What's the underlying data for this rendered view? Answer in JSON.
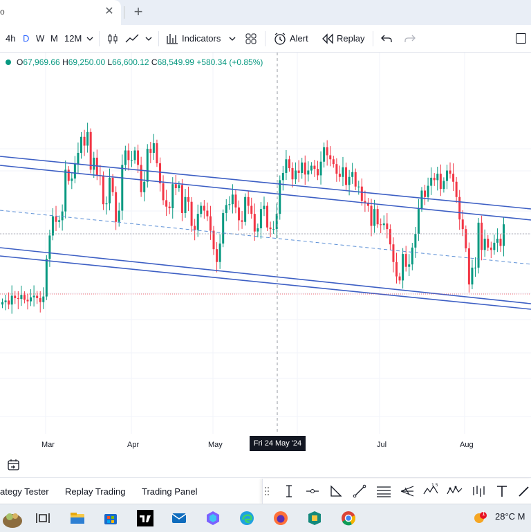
{
  "browser": {
    "tab_glyph": "o",
    "close_glyph": "✕",
    "newtab_glyph": "+"
  },
  "toolbar": {
    "intervals": [
      "4h",
      "D",
      "W",
      "M",
      "12M"
    ],
    "active_interval": "D",
    "indicators_label": "Indicators",
    "alert_label": "Alert",
    "replay_label": "Replay"
  },
  "legend": {
    "open_label": "O",
    "open": "67,969.66",
    "high_label": "H",
    "high": "69,250.00",
    "low_label": "L",
    "low": "66,600.12",
    "close_label": "C",
    "close": "68,549.99",
    "change": "+580.34 (+0.85%)"
  },
  "date_axis": {
    "ticks": [
      "Mar",
      "Apr",
      "May",
      "Jul",
      "Aug"
    ],
    "crosshair_label": "Fri 24 May '24"
  },
  "bottom_tabs": [
    "ategy Tester",
    "Replay Trading",
    "Trading Panel"
  ],
  "taskbar": {
    "temperature": "28°C",
    "weather_suffix": "M",
    "badge": "1"
  },
  "colors": {
    "up": "#089981",
    "down": "#f23645",
    "channel": "#3d5fc4",
    "midline": "#5b8fd6",
    "accent": "#2962ff"
  },
  "chart_data": {
    "type": "candlestick",
    "symbol_interval": "D",
    "period": "Feb–Aug 2024",
    "x_ticks": [
      "Mar",
      "Apr",
      "May",
      "Jul",
      "Aug"
    ],
    "crosshair_date": "Fri 24 May '24",
    "last_bar": {
      "open": 67969.66,
      "high": 69250.0,
      "low": 66600.12,
      "close": 68549.99,
      "change": 580.34,
      "change_pct": 0.85
    },
    "closes": [
      51800,
      52000,
      51500,
      52600,
      52300,
      52200,
      52700,
      52100,
      51900,
      52400,
      52600,
      52300,
      51800,
      52500,
      57200,
      60100,
      62500,
      61800,
      62000,
      63100,
      68300,
      66900,
      67200,
      69000,
      70400,
      72400,
      71300,
      73000,
      68300,
      69800,
      67600,
      67500,
      64000,
      64100,
      67300,
      65500,
      61800,
      63200,
      68900,
      70700,
      69500,
      69500,
      70700,
      68900,
      65500,
      66800,
      70900,
      70400,
      71600,
      69100,
      66600,
      64500,
      63700,
      63500,
      66500,
      66000,
      66400,
      62900,
      64900,
      64300,
      61300,
      60800,
      62800,
      63800,
      63200,
      62500,
      60700,
      58400,
      56800,
      59100,
      62900,
      63900,
      64000,
      65200,
      63600,
      62000,
      61800,
      64900,
      63800,
      62800,
      60600,
      61000,
      63400,
      63800,
      61100,
      60900,
      60900,
      62800,
      67000,
      67900,
      69600,
      68500,
      67100,
      68200,
      67900,
      69200,
      67700,
      68200,
      68800,
      68400,
      67600,
      69300,
      71100,
      70100,
      69600,
      69000,
      67800,
      67400,
      68600,
      66400,
      67400,
      68000,
      66200,
      66200,
      64400,
      64200,
      63800,
      61300,
      63400,
      61500,
      61400,
      61600,
      60900,
      59000,
      56800,
      55000,
      54500,
      57800,
      56200,
      56500,
      58600,
      60300,
      63500,
      65700,
      64900,
      66300,
      67300,
      67000,
      67800,
      65900,
      66900,
      68200,
      67800,
      66800,
      64900,
      62100,
      60900,
      58500,
      54000,
      56100,
      56100,
      61700,
      58300,
      59700,
      58600,
      58300,
      59200,
      59700,
      58800,
      61500
    ]
  }
}
